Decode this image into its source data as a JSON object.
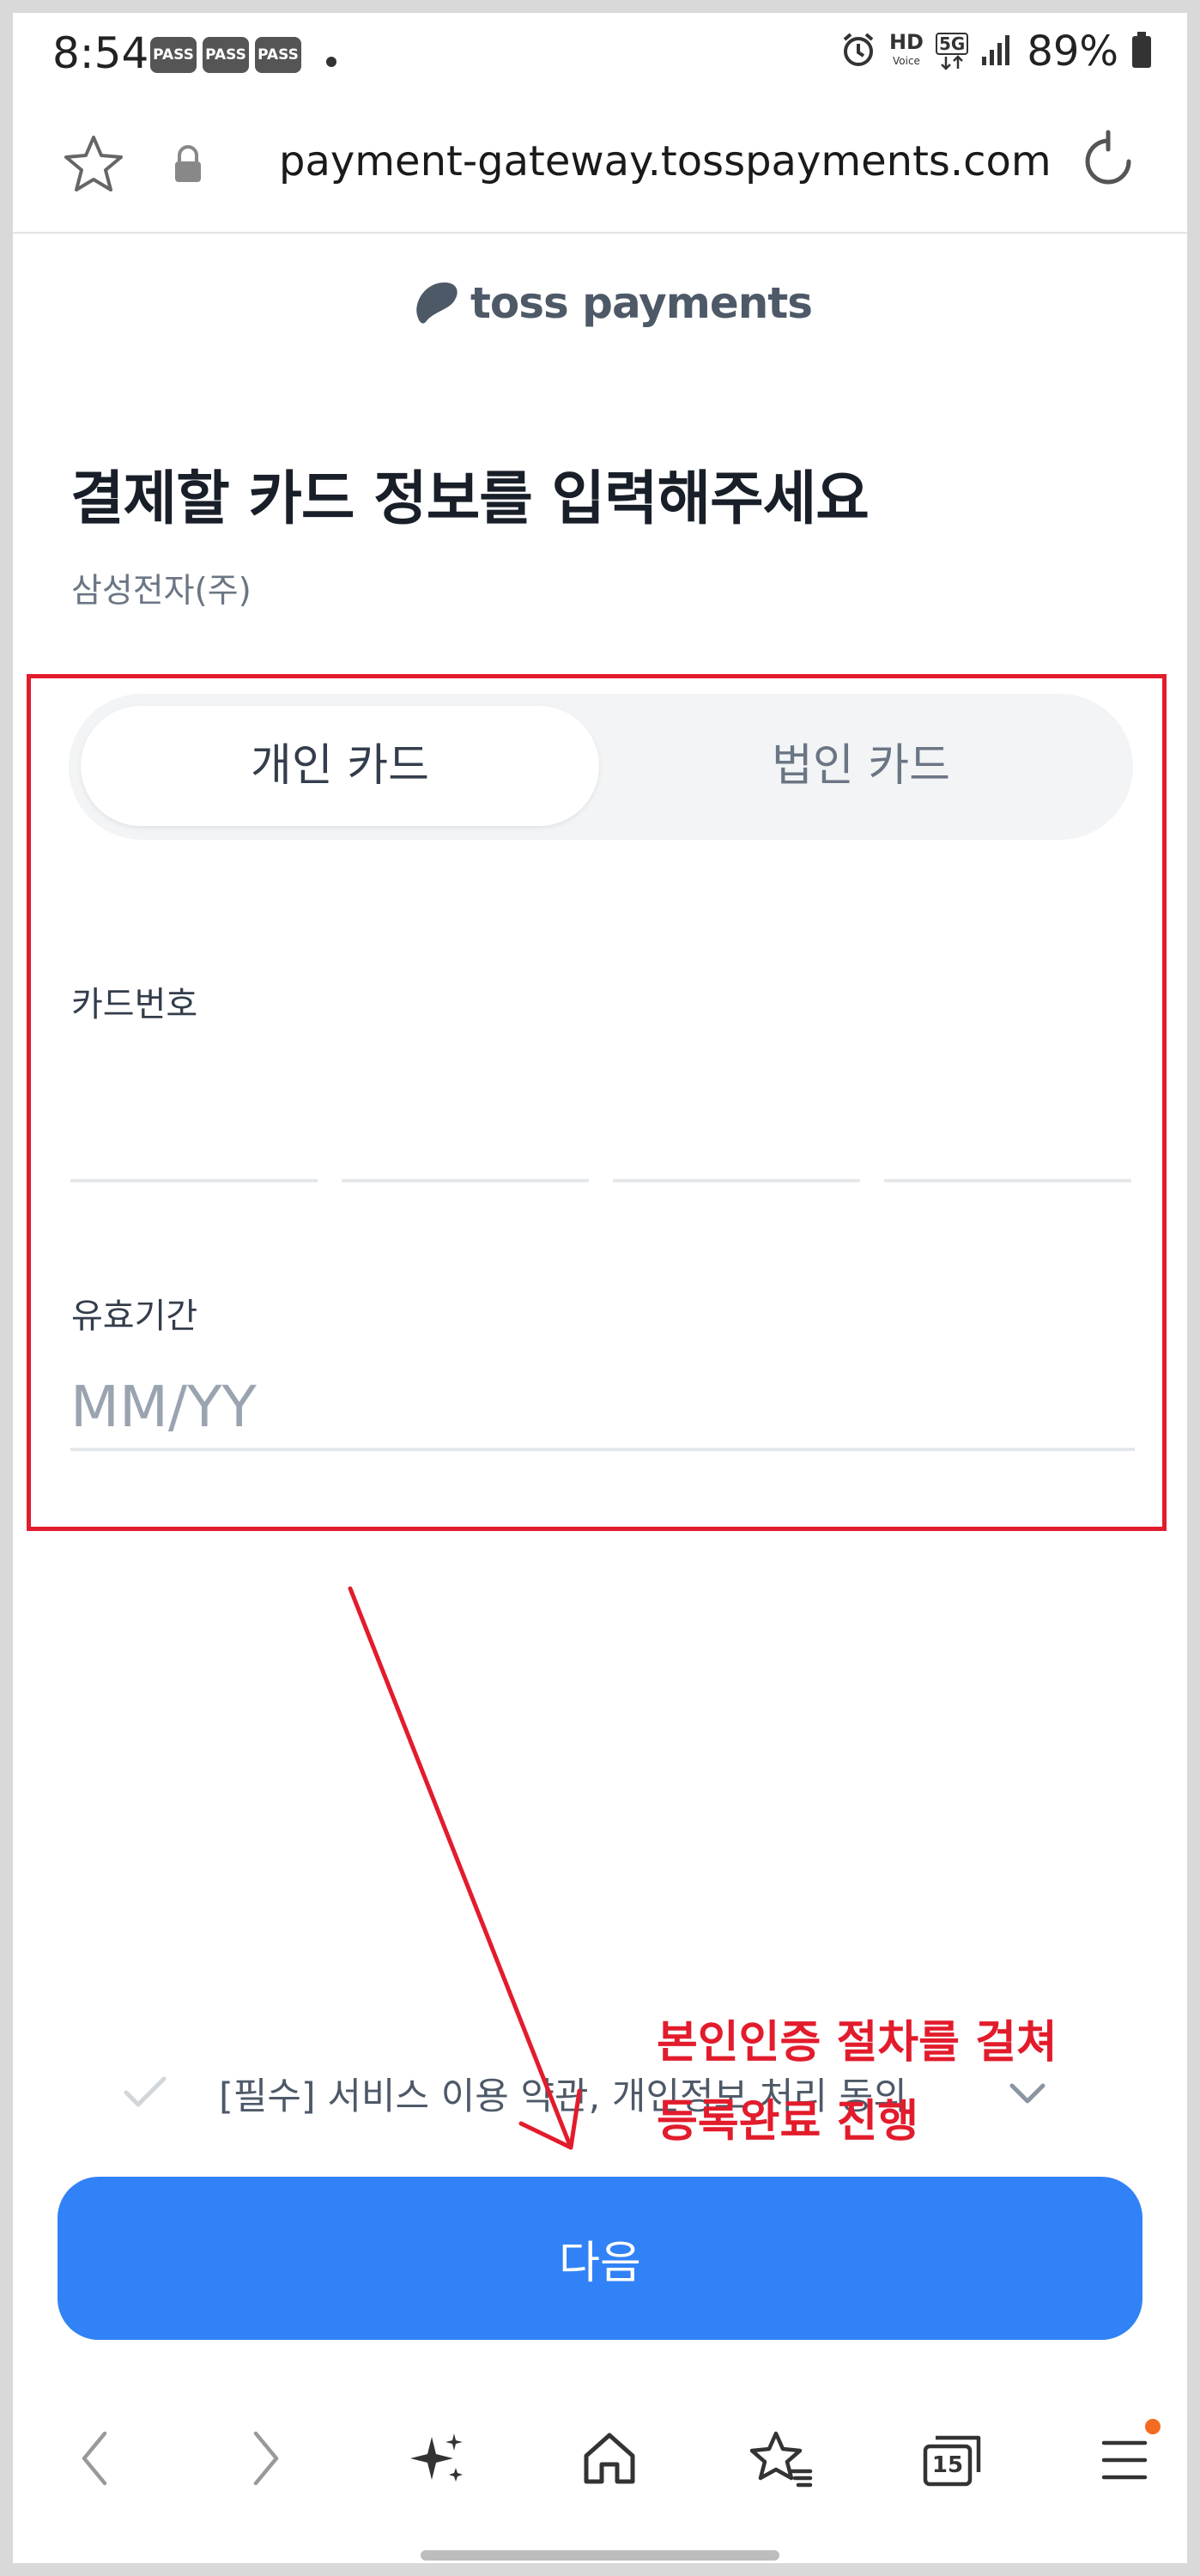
{
  "status_bar": {
    "time": "8:54",
    "badges": [
      "PASS",
      "PASS",
      "PASS"
    ],
    "hd_label": "HD",
    "voice_label": "Voice",
    "network": "5G",
    "battery": "89%"
  },
  "browser": {
    "url": "payment-gateway.tosspayments.com"
  },
  "brand": {
    "logo_text": "toss payments"
  },
  "page": {
    "title": "결제할 카드 정보를 입력해주세요",
    "merchant": "삼성전자(주)"
  },
  "card_type": {
    "personal": "개인 카드",
    "corporate": "법인 카드",
    "selected": "personal"
  },
  "form": {
    "card_number_label": "카드번호",
    "expiry_label": "유효기간",
    "expiry_placeholder": "MM/YY"
  },
  "terms": {
    "text": "[필수] 서비스 이용 약관, 개인정보 처리 동의"
  },
  "annotation": {
    "line1": "본인인증 절차를 걸쳐",
    "line2": "등록완료 진행"
  },
  "buttons": {
    "next": "다음"
  },
  "bottom_nav": {
    "tabs_count": "15"
  },
  "colors": {
    "primary": "#3182f6",
    "annotation": "#e21c2c",
    "notification_dot": "#f26b21"
  }
}
